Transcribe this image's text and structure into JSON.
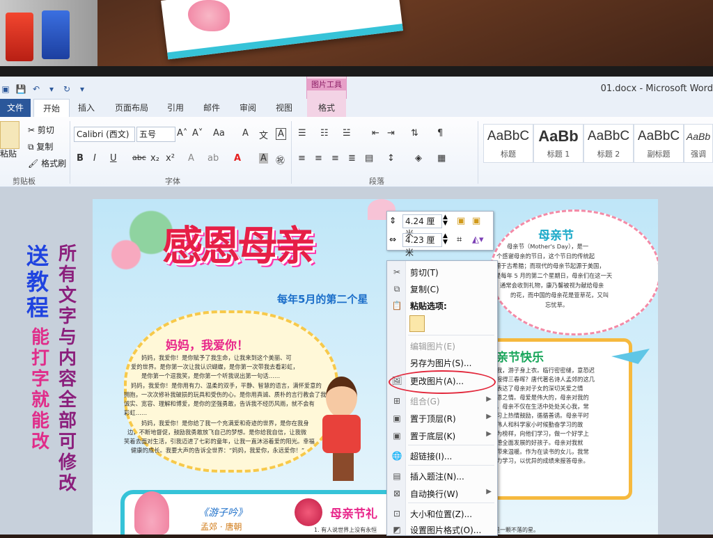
{
  "app": {
    "window_title": "01.docx - Microsoft Word"
  },
  "side_promo": {
    "blue_text": "送教程",
    "pink_text": "能打字就能改",
    "purple_text": "所有文字与内容全部可修改"
  },
  "ribbon": {
    "context_tab_group": "图片工具",
    "context_tab": "格式",
    "tabs": [
      {
        "label": "文件"
      },
      {
        "label": "开始"
      },
      {
        "label": "插入"
      },
      {
        "label": "页面布局"
      },
      {
        "label": "引用"
      },
      {
        "label": "邮件"
      },
      {
        "label": "审阅"
      },
      {
        "label": "视图"
      }
    ],
    "clipboard": {
      "paste": "粘贴",
      "cut": "剪切",
      "copy": "复制",
      "format_painter": "格式刷",
      "group_label": "剪贴板"
    },
    "font": {
      "font_name": "Calibri (西文)",
      "font_size": "五号",
      "group_label": "字体"
    },
    "paragraph": {
      "group_label": "段落"
    },
    "styles": [
      {
        "preview": "AaBbC",
        "name": "标题"
      },
      {
        "preview": "AaBb",
        "name": "标题 1"
      },
      {
        "preview": "AaBbC",
        "name": "标题 2"
      },
      {
        "preview": "AaBbC",
        "name": "副标题"
      },
      {
        "preview": "AaBb",
        "name": "强调"
      }
    ]
  },
  "poster": {
    "title": "感恩母亲",
    "subtitle": "每年5月的第二个星",
    "cloud_title": "妈妈，我爱你！",
    "cloud_text": [
      "妈妈，我爱你！是你赋予了我生命，让我来到这个美丽、可",
      "爱的世界。是你第一次让我认识蝴蝶，是你第一次带我去看彩虹，",
      "是你第一个逗我笑，是你第一个听我说出第一句话……",
      "妈妈，我爱你！是你用有力、温柔的双手，平静、智慧的语言，满怀爱意的",
      "拥抱，一次次修补我破损的玩具和受伤的心。是你用真诚、质朴的言行教会了我",
      "诚实、宽容、理解和博爱，是你的坚强勇敢，告诉我不经历风雨，就不会有",
      "彩虹……",
      "妈妈，我爱你！是你给了我一个充满爱和奇迹的世界，是你在我身",
      "边，不断地督促，鼓励我勇敢放飞自己的梦想。是你给我自信，让我微",
      "笑着去面对生活，引我迈进了七彩的童年，让我一直沐浴着爱的阳光。幸福",
      "健康的成长。我要大声的告诉全世界：“妈妈，我爱你，永远爱你！”"
    ],
    "right_title": "母亲节",
    "right_text": [
      "母亲节（Mother's Day），是一",
      "个感谢母亲的节日，这个节日的传统起",
      "源于古希腊；而现代的母亲节起源于美国，",
      "是每年 5 月的第二个星期日，母亲们在这一天",
      "通常会收到礼物，康乃馨被视为献给母亲",
      "的花，而中国的母亲花是萱草花，又叫",
      "忘忧草。"
    ],
    "right_title2": "亲节快乐",
    "right_box_text": [
      "我，游子身上衣。临行密密缝，意恐迟",
      "报得三春晖？唐代著名诗人孟郊的这几",
      "表达了母亲对子女的深切关爱之情",
      "恩之情。母爱是伟大的，母亲对我的",
      "。母亲不仅在生活中处处关心我，常",
      "习上热情鼓励，循循善诱。母亲平时",
      "伟人和科学家小时候勤奋学习的故",
      "为榜样，向他们学习，做一个好学上",
      "德全面发展的好孩子。母亲对我就",
      "带来温暖。作为在读书的女儿，我常",
      "力学习，以优异的成绩来报答母亲。"
    ],
    "poem_title": "《游子吟》",
    "poem_author": "孟郊 · 唐朝",
    "bottom_title": "母亲节礼",
    "bottom_line": "1. 有人说世界上没有永恒",
    "bottom_right_line": "是一颗不落的星。"
  },
  "size_box": {
    "height_value": "4.24 厘米",
    "width_value": "4.23 厘米"
  },
  "context_menu": {
    "items": [
      {
        "label": "剪切(T)",
        "icon": "scissors-icon",
        "disabled": false
      },
      {
        "label": "复制(C)",
        "icon": "copy-icon",
        "disabled": false
      },
      {
        "label": "粘贴选项:",
        "icon": "paste-icon",
        "disabled": false
      },
      {
        "label": "编辑图片(E)",
        "icon": "",
        "disabled": true
      },
      {
        "label": "另存为图片(S)...",
        "icon": "",
        "disabled": false
      },
      {
        "label": "更改图片(A)...",
        "icon": "change-picture-icon",
        "disabled": false
      },
      {
        "label": "组合(G)",
        "icon": "group-icon",
        "disabled": true
      },
      {
        "label": "置于顶层(R)",
        "icon": "bring-front-icon",
        "disabled": false
      },
      {
        "label": "置于底层(K)",
        "icon": "send-back-icon",
        "disabled": false
      },
      {
        "label": "超链接(I)...",
        "icon": "hyperlink-icon",
        "disabled": false
      },
      {
        "label": "插入题注(N)...",
        "icon": "caption-icon",
        "disabled": false
      },
      {
        "label": "自动换行(W)",
        "icon": "wrap-icon",
        "disabled": false
      },
      {
        "label": "大小和位置(Z)...",
        "icon": "size-icon",
        "disabled": false
      },
      {
        "label": "设置图片格式(O)...",
        "icon": "format-icon",
        "disabled": false
      }
    ]
  },
  "colors": {
    "accent": "#2b579a",
    "context_tab": "#e7a0c8",
    "highlight": "#e2263a"
  }
}
